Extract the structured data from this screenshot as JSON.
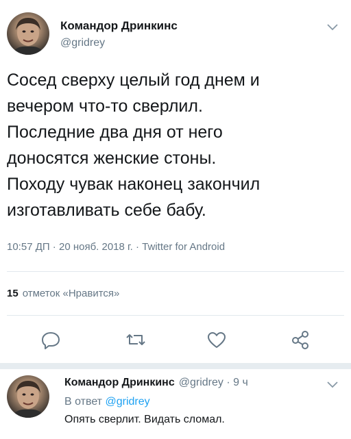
{
  "tweet": {
    "author_name": "Командор Дринкинс",
    "author_handle": "@gridrey",
    "text_lines": [
      "Сосед сверху целый год днем и",
      "вечером что-то сверлил.",
      "Последние два дня от него",
      "доносятся женские стоны.",
      "Походу чувак наконец закончил",
      "изготавливать себе бабу."
    ],
    "meta": "10:57 ДП · 20 нояб. 2018 г. · Twitter for Android",
    "likes_count": "15",
    "likes_label": "отметок «Нравится»"
  },
  "icons": {
    "reply": "reply-icon",
    "retweet": "retweet-icon",
    "like": "heart-icon",
    "share": "share-icon",
    "menu": "chevron-down-icon"
  },
  "reply": {
    "author_name": "Командор Дринкинс",
    "author_handle": "@gridrey",
    "time": "· 9 ч",
    "reply_to_label": "В ответ",
    "reply_to_handle": "@gridrey",
    "text": "Опять сверлит. Видать сломал."
  },
  "colors": {
    "text": "#14171a",
    "secondary": "#657786",
    "link": "#1da1f2",
    "divider": "#e1e8ed"
  }
}
